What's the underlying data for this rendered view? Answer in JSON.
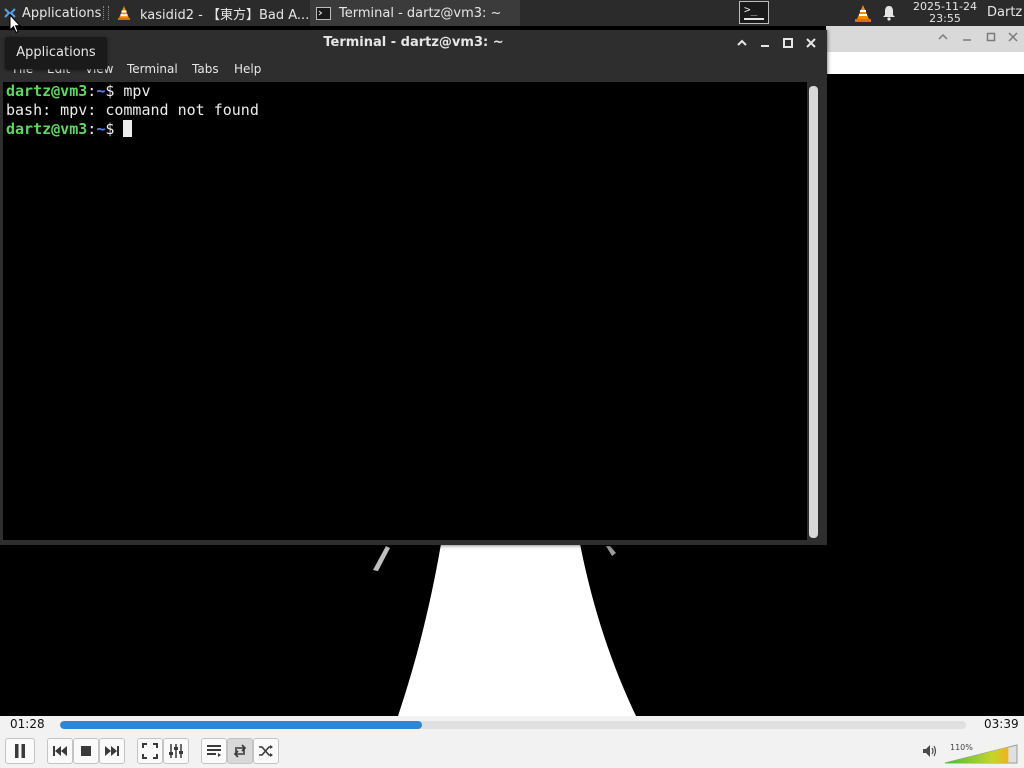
{
  "panel": {
    "apps_label": "Applications",
    "tasks": [
      {
        "label": "kasidid2 - 【東方】Bad A...",
        "icon": "vlc-cone-icon",
        "active": false
      },
      {
        "label": "Terminal - dartz@vm3: ~",
        "icon": "terminal-window-icon",
        "active": true
      }
    ],
    "terminal_launcher_icon": "terminal-launcher-icon",
    "terminal_launcher_glyph": ">_",
    "tray_icons": [
      "vlc-tray-icon",
      "notification-bell-icon"
    ],
    "date": "2025-11-24",
    "time": "23:55",
    "user": "Dartz"
  },
  "tooltip": {
    "text": "Applications"
  },
  "terminal": {
    "title": "Terminal - dartz@vm3: ~",
    "menu": [
      "File",
      "Edit",
      "View",
      "Terminal",
      "Tabs",
      "Help"
    ],
    "window_controls": [
      "collapse-up-icon",
      "minimize-icon",
      "maximize-icon",
      "close-icon"
    ],
    "lines": [
      {
        "user_host": "dartz@vm3",
        "path": "~",
        "symbol": "$",
        "command": "mpv"
      },
      {
        "output": "bash: mpv: command not found"
      },
      {
        "user_host": "dartz@vm3",
        "path": "~",
        "symbol": "$",
        "command": ""
      }
    ],
    "colors": {
      "prompt": "#5fd75f",
      "path": "#5f87ff",
      "background": "#000000",
      "text": "#ececec"
    }
  },
  "vlc": {
    "elapsed": "01:28",
    "total": "03:39",
    "progress": 0.4,
    "volume_label": "110%",
    "volume": 1.1,
    "accent": "#2f86d6",
    "controls": [
      "pause-icon",
      "previous-icon",
      "stop-icon",
      "next-icon",
      "fullscreen-icon",
      "extended-settings-icon",
      "playlist-icon",
      "loop-icon",
      "shuffle-icon",
      "volume-icon"
    ]
  }
}
